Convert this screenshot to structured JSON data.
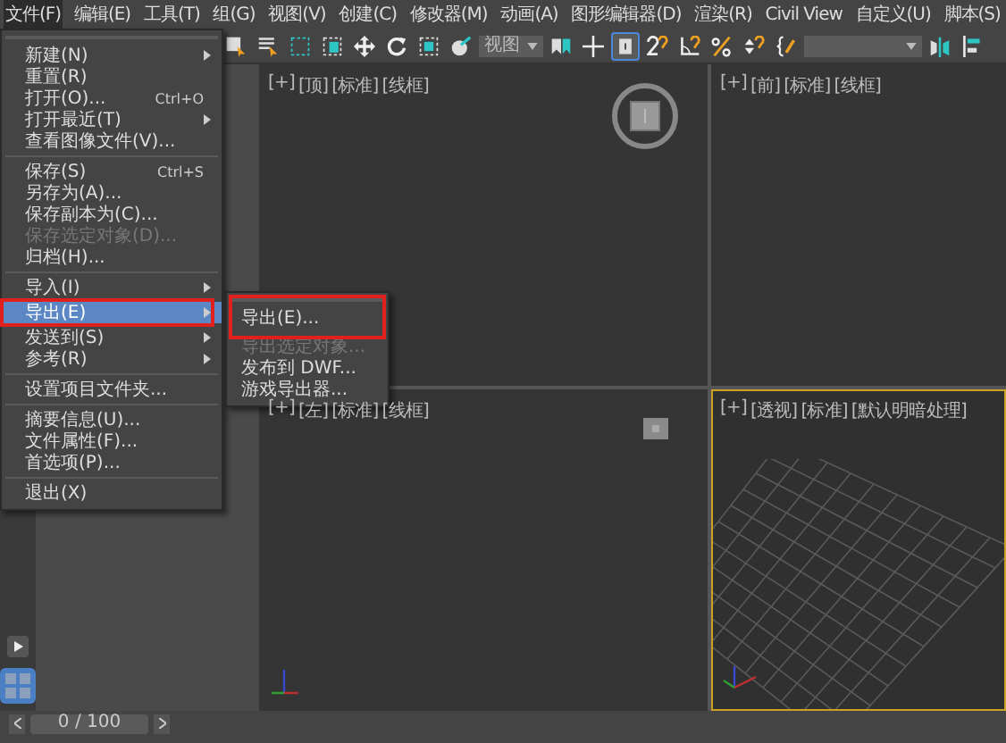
{
  "menubar": {
    "items": [
      {
        "label": "文件(F)",
        "selected": true
      },
      {
        "label": "编辑(E)",
        "selected": false
      },
      {
        "label": "工具(T)",
        "selected": false
      },
      {
        "label": "组(G)",
        "selected": false
      },
      {
        "label": "视图(V)",
        "selected": false
      },
      {
        "label": "创建(C)",
        "selected": false
      },
      {
        "label": "修改器(M)",
        "selected": false
      },
      {
        "label": "动画(A)",
        "selected": false
      },
      {
        "label": "图形编辑器(D)",
        "selected": false
      },
      {
        "label": "渲染(R)",
        "selected": false
      },
      {
        "label": "Civil View",
        "selected": false
      },
      {
        "label": "自定义(U)",
        "selected": false
      },
      {
        "label": "脚本(S)",
        "selected": false
      }
    ]
  },
  "toolbar": {
    "tools": [
      {
        "kind": "select",
        "selected": false
      },
      {
        "kind": "select-by-name",
        "selected": false
      },
      {
        "kind": "rect-region",
        "selected": false
      },
      {
        "kind": "window-crossing",
        "selected": false
      },
      {
        "kind": "move",
        "selected": false
      },
      {
        "kind": "rotate",
        "selected": false
      },
      {
        "kind": "scale",
        "selected": false
      },
      {
        "kind": "place",
        "selected": false
      },
      {
        "kind": "dropdown",
        "value": "视图"
      },
      {
        "kind": "pivot",
        "selected": false
      },
      {
        "kind": "manipulate",
        "selected": false
      },
      {
        "kind": "keyboard",
        "selected": true
      },
      {
        "kind": "snap",
        "selected": false
      },
      {
        "kind": "angle-snap",
        "selected": false
      },
      {
        "kind": "percent-snap",
        "selected": false
      },
      {
        "kind": "spinner-snap",
        "selected": false
      },
      {
        "kind": "named-selection",
        "selected": false
      },
      {
        "kind": "dropdown"
      },
      {
        "kind": "mirror",
        "selected": false
      },
      {
        "kind": "align",
        "selected": false
      }
    ]
  },
  "file_menu": {
    "items": [
      {
        "kind": "item",
        "label": "新建(N)",
        "submenu": true,
        "disabled": false,
        "selected": false
      },
      {
        "kind": "item",
        "label": "重置(R)",
        "submenu": false,
        "disabled": false,
        "selected": false
      },
      {
        "kind": "item",
        "label": "打开(O)...",
        "shortcut": "Ctrl+O",
        "submenu": false,
        "disabled": false,
        "selected": false
      },
      {
        "kind": "item",
        "label": "打开最近(T)",
        "submenu": true,
        "disabled": false,
        "selected": false
      },
      {
        "kind": "item",
        "label": "查看图像文件(V)...",
        "submenu": false,
        "disabled": false,
        "selected": false
      },
      {
        "kind": "separator"
      },
      {
        "kind": "item",
        "label": "保存(S)",
        "shortcut": "Ctrl+S",
        "submenu": false,
        "disabled": false,
        "selected": false
      },
      {
        "kind": "item",
        "label": "另存为(A)...",
        "submenu": false,
        "disabled": false,
        "selected": false
      },
      {
        "kind": "item",
        "label": "保存副本为(C)...",
        "submenu": false,
        "disabled": false,
        "selected": false
      },
      {
        "kind": "item",
        "label": "保存选定对象(D)...",
        "submenu": false,
        "disabled": true,
        "selected": false
      },
      {
        "kind": "item",
        "label": "归档(H)...",
        "submenu": false,
        "disabled": false,
        "selected": false
      },
      {
        "kind": "separator"
      },
      {
        "kind": "item",
        "label": "导入(I)",
        "submenu": true,
        "disabled": false,
        "selected": false
      },
      {
        "kind": "item",
        "label": "导出(E)",
        "submenu": true,
        "disabled": false,
        "selected": true,
        "highlighted": true
      },
      {
        "kind": "item",
        "label": "发送到(S)",
        "submenu": true,
        "disabled": false,
        "selected": false
      },
      {
        "kind": "item",
        "label": "参考(R)",
        "submenu": true,
        "disabled": false,
        "selected": false
      },
      {
        "kind": "separator"
      },
      {
        "kind": "item",
        "label": "设置项目文件夹...",
        "submenu": false,
        "disabled": false,
        "selected": false
      },
      {
        "kind": "separator"
      },
      {
        "kind": "item",
        "label": "摘要信息(U)...",
        "submenu": false,
        "disabled": false,
        "selected": false
      },
      {
        "kind": "item",
        "label": "文件属性(F)...",
        "submenu": false,
        "disabled": false,
        "selected": false
      },
      {
        "kind": "item",
        "label": "首选项(P)...",
        "submenu": false,
        "disabled": false,
        "selected": false
      },
      {
        "kind": "separator"
      },
      {
        "kind": "item",
        "label": "退出(X)",
        "submenu": false,
        "disabled": false,
        "selected": false
      }
    ]
  },
  "export_submenu": {
    "items": [
      {
        "label": "导出(E)...",
        "disabled": false,
        "highlighted": true
      },
      {
        "label": "导出选定对象...",
        "disabled": true,
        "highlighted": false
      },
      {
        "label": "发布到 DWF...",
        "disabled": false,
        "highlighted": false
      },
      {
        "label": "游戏导出器...",
        "disabled": false,
        "highlighted": false
      }
    ]
  },
  "viewports": [
    {
      "tags": [
        "[+]",
        "[顶]",
        "[标准]",
        "[线框]"
      ],
      "active": false,
      "kind": "top"
    },
    {
      "tags": [
        "[+]",
        "[前]",
        "[标准]",
        "[线框]"
      ],
      "active": false,
      "kind": "front"
    },
    {
      "tags": [
        "[+]",
        "[左]",
        "[标准]",
        "[线框]"
      ],
      "active": false,
      "kind": "left"
    },
    {
      "tags": [
        "[+]",
        "[透视]",
        "[标准]",
        "[默认明暗处理]"
      ],
      "active": true,
      "kind": "perspective"
    }
  ],
  "timeline": {
    "frame": "0 / 100"
  }
}
